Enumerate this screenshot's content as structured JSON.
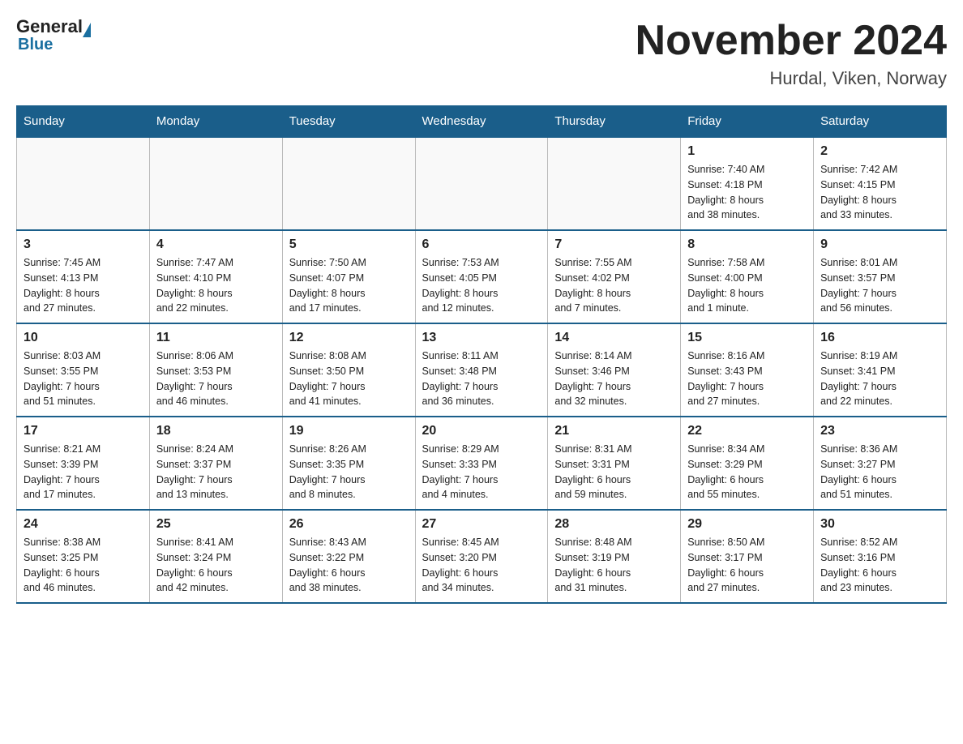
{
  "logo": {
    "general": "General",
    "blue": "Blue"
  },
  "header": {
    "title": "November 2024",
    "location": "Hurdal, Viken, Norway"
  },
  "weekdays": [
    "Sunday",
    "Monday",
    "Tuesday",
    "Wednesday",
    "Thursday",
    "Friday",
    "Saturday"
  ],
  "weeks": [
    [
      {
        "day": "",
        "info": ""
      },
      {
        "day": "",
        "info": ""
      },
      {
        "day": "",
        "info": ""
      },
      {
        "day": "",
        "info": ""
      },
      {
        "day": "",
        "info": ""
      },
      {
        "day": "1",
        "info": "Sunrise: 7:40 AM\nSunset: 4:18 PM\nDaylight: 8 hours\nand 38 minutes."
      },
      {
        "day": "2",
        "info": "Sunrise: 7:42 AM\nSunset: 4:15 PM\nDaylight: 8 hours\nand 33 minutes."
      }
    ],
    [
      {
        "day": "3",
        "info": "Sunrise: 7:45 AM\nSunset: 4:13 PM\nDaylight: 8 hours\nand 27 minutes."
      },
      {
        "day": "4",
        "info": "Sunrise: 7:47 AM\nSunset: 4:10 PM\nDaylight: 8 hours\nand 22 minutes."
      },
      {
        "day": "5",
        "info": "Sunrise: 7:50 AM\nSunset: 4:07 PM\nDaylight: 8 hours\nand 17 minutes."
      },
      {
        "day": "6",
        "info": "Sunrise: 7:53 AM\nSunset: 4:05 PM\nDaylight: 8 hours\nand 12 minutes."
      },
      {
        "day": "7",
        "info": "Sunrise: 7:55 AM\nSunset: 4:02 PM\nDaylight: 8 hours\nand 7 minutes."
      },
      {
        "day": "8",
        "info": "Sunrise: 7:58 AM\nSunset: 4:00 PM\nDaylight: 8 hours\nand 1 minute."
      },
      {
        "day": "9",
        "info": "Sunrise: 8:01 AM\nSunset: 3:57 PM\nDaylight: 7 hours\nand 56 minutes."
      }
    ],
    [
      {
        "day": "10",
        "info": "Sunrise: 8:03 AM\nSunset: 3:55 PM\nDaylight: 7 hours\nand 51 minutes."
      },
      {
        "day": "11",
        "info": "Sunrise: 8:06 AM\nSunset: 3:53 PM\nDaylight: 7 hours\nand 46 minutes."
      },
      {
        "day": "12",
        "info": "Sunrise: 8:08 AM\nSunset: 3:50 PM\nDaylight: 7 hours\nand 41 minutes."
      },
      {
        "day": "13",
        "info": "Sunrise: 8:11 AM\nSunset: 3:48 PM\nDaylight: 7 hours\nand 36 minutes."
      },
      {
        "day": "14",
        "info": "Sunrise: 8:14 AM\nSunset: 3:46 PM\nDaylight: 7 hours\nand 32 minutes."
      },
      {
        "day": "15",
        "info": "Sunrise: 8:16 AM\nSunset: 3:43 PM\nDaylight: 7 hours\nand 27 minutes."
      },
      {
        "day": "16",
        "info": "Sunrise: 8:19 AM\nSunset: 3:41 PM\nDaylight: 7 hours\nand 22 minutes."
      }
    ],
    [
      {
        "day": "17",
        "info": "Sunrise: 8:21 AM\nSunset: 3:39 PM\nDaylight: 7 hours\nand 17 minutes."
      },
      {
        "day": "18",
        "info": "Sunrise: 8:24 AM\nSunset: 3:37 PM\nDaylight: 7 hours\nand 13 minutes."
      },
      {
        "day": "19",
        "info": "Sunrise: 8:26 AM\nSunset: 3:35 PM\nDaylight: 7 hours\nand 8 minutes."
      },
      {
        "day": "20",
        "info": "Sunrise: 8:29 AM\nSunset: 3:33 PM\nDaylight: 7 hours\nand 4 minutes."
      },
      {
        "day": "21",
        "info": "Sunrise: 8:31 AM\nSunset: 3:31 PM\nDaylight: 6 hours\nand 59 minutes."
      },
      {
        "day": "22",
        "info": "Sunrise: 8:34 AM\nSunset: 3:29 PM\nDaylight: 6 hours\nand 55 minutes."
      },
      {
        "day": "23",
        "info": "Sunrise: 8:36 AM\nSunset: 3:27 PM\nDaylight: 6 hours\nand 51 minutes."
      }
    ],
    [
      {
        "day": "24",
        "info": "Sunrise: 8:38 AM\nSunset: 3:25 PM\nDaylight: 6 hours\nand 46 minutes."
      },
      {
        "day": "25",
        "info": "Sunrise: 8:41 AM\nSunset: 3:24 PM\nDaylight: 6 hours\nand 42 minutes."
      },
      {
        "day": "26",
        "info": "Sunrise: 8:43 AM\nSunset: 3:22 PM\nDaylight: 6 hours\nand 38 minutes."
      },
      {
        "day": "27",
        "info": "Sunrise: 8:45 AM\nSunset: 3:20 PM\nDaylight: 6 hours\nand 34 minutes."
      },
      {
        "day": "28",
        "info": "Sunrise: 8:48 AM\nSunset: 3:19 PM\nDaylight: 6 hours\nand 31 minutes."
      },
      {
        "day": "29",
        "info": "Sunrise: 8:50 AM\nSunset: 3:17 PM\nDaylight: 6 hours\nand 27 minutes."
      },
      {
        "day": "30",
        "info": "Sunrise: 8:52 AM\nSunset: 3:16 PM\nDaylight: 6 hours\nand 23 minutes."
      }
    ]
  ]
}
